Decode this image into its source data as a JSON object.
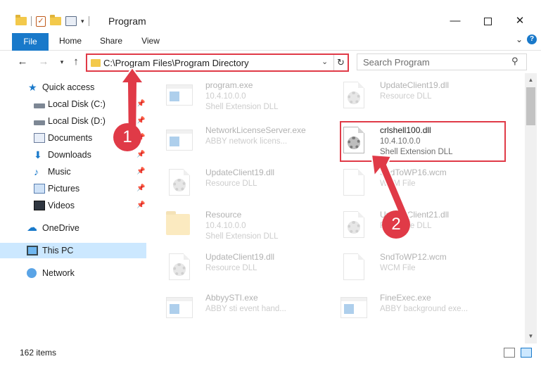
{
  "window": {
    "title": "Program",
    "minimize": "—",
    "close": "✕"
  },
  "ribbon": {
    "tabs": [
      "File",
      "Home",
      "Share",
      "View"
    ],
    "expand_icon": "chevron-down-icon",
    "help_icon": "?"
  },
  "address": {
    "path": "C:\\Program Files\\Program Directory",
    "search_placeholder": "Search Program"
  },
  "nav_pane": {
    "items": [
      {
        "label": "Quick access",
        "icon": "star-icon",
        "pinned": false
      },
      {
        "label": "Local Disk (C:)",
        "icon": "disk-icon",
        "pinned": true
      },
      {
        "label": "Local Disk (D:)",
        "icon": "disk-icon",
        "pinned": true
      },
      {
        "label": "Documents",
        "icon": "documents-icon",
        "pinned": true
      },
      {
        "label": "Downloads",
        "icon": "download-icon",
        "pinned": true
      },
      {
        "label": "Music",
        "icon": "music-icon",
        "pinned": true
      },
      {
        "label": "Pictures",
        "icon": "pictures-icon",
        "pinned": true
      },
      {
        "label": "Videos",
        "icon": "videos-icon",
        "pinned": true
      },
      {
        "label": "OneDrive",
        "icon": "cloud-icon",
        "pinned": false
      },
      {
        "label": "This PC",
        "icon": "computer-icon",
        "pinned": false,
        "selected": true
      },
      {
        "label": "Network",
        "icon": "network-icon",
        "pinned": false
      }
    ]
  },
  "files": [
    {
      "name": "program.exe",
      "meta1": "10.4.10.0.0",
      "meta2": "Shell Extension DLL",
      "icon": "installer-icon"
    },
    {
      "name": "UpdateClient19.dll",
      "meta1": "Resource DLL",
      "meta2": "",
      "icon": "dll-gear-icon"
    },
    {
      "name": "NetworkLicenseServer.exe",
      "meta1": "ABBY network licens...",
      "meta2": "",
      "icon": "exe-icon"
    },
    {
      "name": "crlshell100.dll",
      "meta1": "10.4.10.0.0",
      "meta2": "Shell Extension DLL",
      "icon": "dll-gear-icon",
      "highlighted": true
    },
    {
      "name": "UpdateClient19.dll",
      "meta1": "Resource DLL",
      "meta2": "",
      "icon": "dll-gear-icon"
    },
    {
      "name": "SndToWP16.wcm",
      "meta1": "WCM File",
      "meta2": "",
      "icon": "file-icon"
    },
    {
      "name": "Resource",
      "meta1": "10.4.10.0.0",
      "meta2": "Shell Extension DLL",
      "icon": "folder-icon"
    },
    {
      "name": "UpdateClient21.dll",
      "meta1": "Resource DLL",
      "meta2": "",
      "icon": "dll-gear-icon"
    },
    {
      "name": "UpdateClient19.dll",
      "meta1": "Resource DLL",
      "meta2": "",
      "icon": "dll-gear-icon"
    },
    {
      "name": "SndToWP12.wcm",
      "meta1": "WCM File",
      "meta2": "",
      "icon": "file-icon"
    },
    {
      "name": "AbbyySTI.exe",
      "meta1": "ABBY sti event hand...",
      "meta2": "",
      "icon": "exe-icon"
    },
    {
      "name": "FineExec.exe",
      "meta1": "ABBY background exe...",
      "meta2": "",
      "icon": "exe-icon"
    }
  ],
  "annotations": {
    "badge1": "1",
    "badge2": "2",
    "color": "#e03a47"
  },
  "status": {
    "item_count": "162 items"
  },
  "colors": {
    "accent": "#1979ca",
    "selection": "#cce8ff"
  }
}
